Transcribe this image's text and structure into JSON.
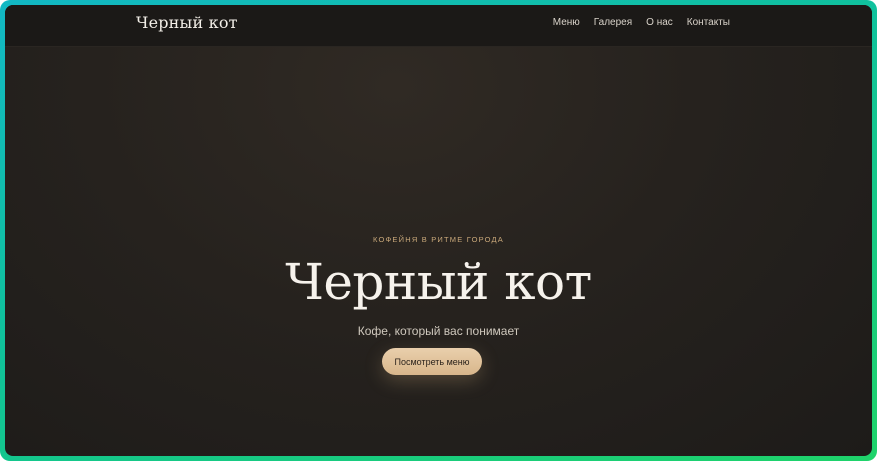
{
  "header": {
    "brand": "Черный кот",
    "nav": [
      {
        "label": "Меню"
      },
      {
        "label": "Галерея"
      },
      {
        "label": "О нас"
      },
      {
        "label": "Контакты"
      }
    ]
  },
  "hero": {
    "eyebrow": "КОФЕЙНЯ В РИТМЕ ГОРОДА",
    "title": "Черный кот",
    "subtitle": "Кофе, который вас понимает",
    "cta_label": "Посмотреть меню"
  },
  "colors": {
    "accent": "#d8b68b",
    "background": "#26221e",
    "frame": "#10c29a"
  }
}
